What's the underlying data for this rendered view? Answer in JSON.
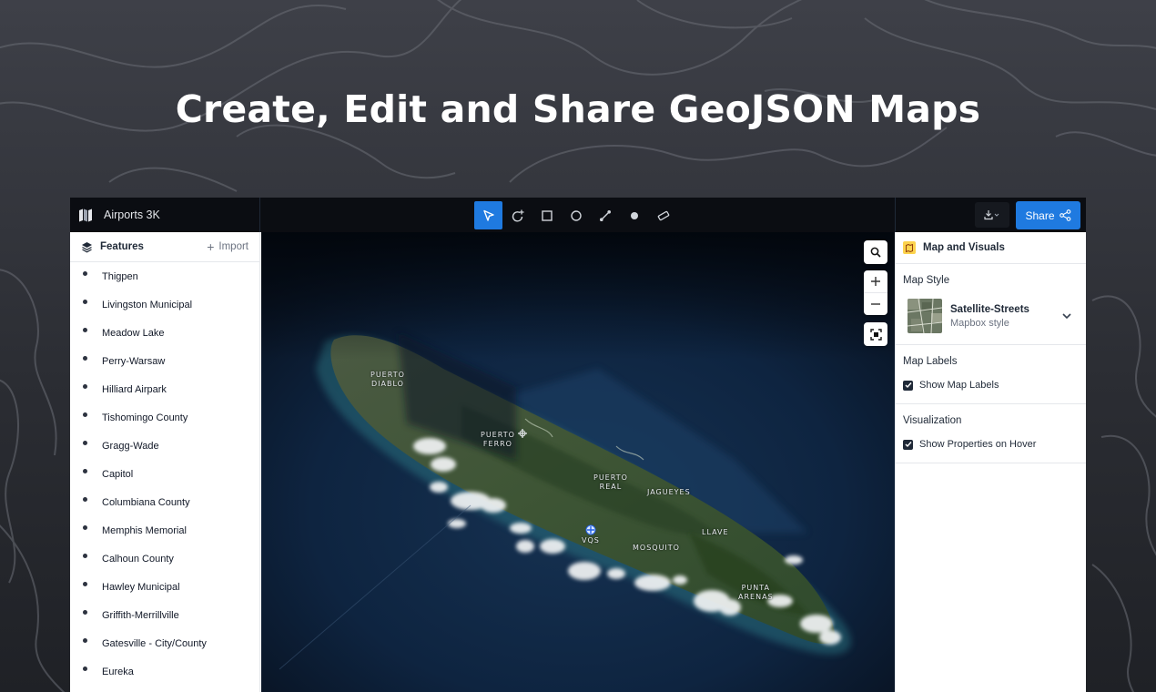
{
  "hero": {
    "title": "Create, Edit and Share GeoJSON Maps"
  },
  "topbar": {
    "project_name": "Airports 3K",
    "tools": [
      {
        "name": "select-tool",
        "icon": "cursor-arrow-icon",
        "active": true
      },
      {
        "name": "lasso-tool",
        "icon": "lasso-plus-icon",
        "active": false
      },
      {
        "name": "rectangle-tool",
        "icon": "square-icon",
        "active": false
      },
      {
        "name": "circle-tool",
        "icon": "circle-icon",
        "active": false
      },
      {
        "name": "line-tool",
        "icon": "line-icon",
        "active": false
      },
      {
        "name": "point-tool",
        "icon": "dot-icon",
        "active": false
      },
      {
        "name": "ruler-tool",
        "icon": "ruler-icon",
        "active": false
      }
    ],
    "share_label": "Share"
  },
  "features": {
    "title": "Features",
    "import_label": "Import",
    "items": [
      "Thigpen",
      "Livingston Municipal",
      "Meadow Lake",
      "Perry-Warsaw",
      "Hilliard Airpark",
      "Tishomingo County",
      "Gragg-Wade",
      "Capitol",
      "Columbiana County",
      "Memphis Memorial",
      "Calhoun County",
      "Hawley Municipal",
      "Griffith-Merrillville",
      "Gatesville - City/County",
      "Eureka"
    ]
  },
  "map": {
    "labels": {
      "puerto_diablo": "PUERTO\nDIABLO",
      "puerto_ferro": "PUERTO\nFERRO",
      "puerto_real": "PUERTO\nREAL",
      "jagueyes": "JAGUEYES",
      "llave": "LLAVE",
      "mosquito": "MOSQUITO",
      "punta_arenas": "PUNTA\nARENAS",
      "vqs": "VQS"
    }
  },
  "panel": {
    "title": "Map and Visuals",
    "map_style_title": "Map Style",
    "style_name": "Satellite-Streets",
    "style_sub": "Mapbox style",
    "map_labels_title": "Map Labels",
    "show_map_labels": "Show Map Labels",
    "visualization_title": "Visualization",
    "show_properties": "Show Properties on Hover"
  },
  "colors": {
    "accent": "#1f7ae0",
    "topbar": "#0b0d12",
    "ocean": "#0c1a2f"
  }
}
